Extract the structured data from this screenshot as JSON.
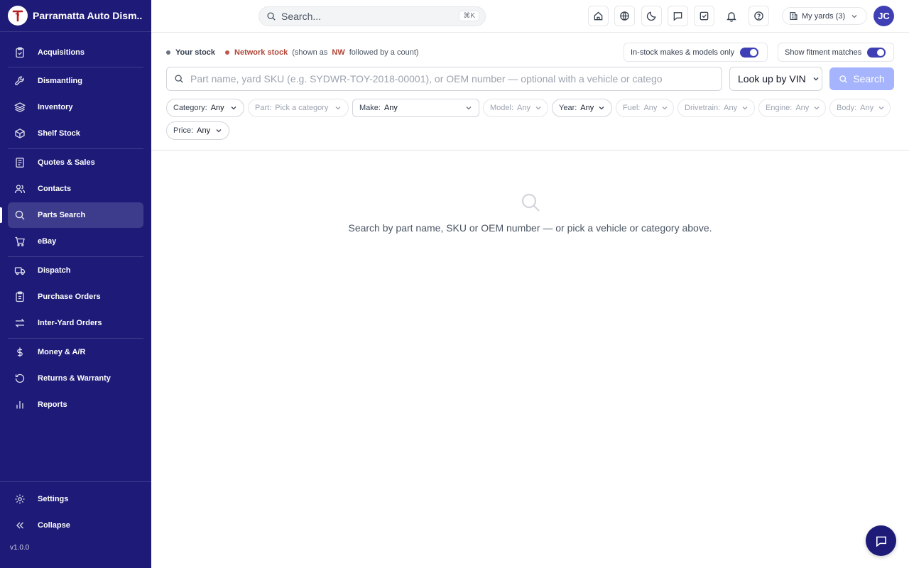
{
  "app": {
    "name": "Parramatta Auto Dism...",
    "version": "v1.0.0",
    "accent": "#1e1b78",
    "brand_color": "#3f3fb5"
  },
  "sidebar": {
    "items": [
      {
        "label": "Acquisitions",
        "icon": "clipboard-icon"
      },
      {
        "label": "Dismantling",
        "icon": "wrench-icon"
      },
      {
        "label": "Inventory",
        "icon": "layers-icon"
      },
      {
        "label": "Shelf Stock",
        "icon": "box-icon"
      },
      {
        "label": "Quotes & Sales",
        "icon": "receipt-icon"
      },
      {
        "label": "Contacts",
        "icon": "users-icon"
      },
      {
        "label": "Parts Search",
        "icon": "search-icon",
        "active": true
      },
      {
        "label": "eBay",
        "icon": "cart-icon"
      },
      {
        "label": "Dispatch",
        "icon": "truck-icon"
      },
      {
        "label": "Purchase Orders",
        "icon": "clipboard-list-icon"
      },
      {
        "label": "Inter-Yard Orders",
        "icon": "swap-icon"
      },
      {
        "label": "Money & A/R",
        "icon": "dollar-icon"
      },
      {
        "label": "Returns & Warranty",
        "icon": "rotate-icon"
      },
      {
        "label": "Reports",
        "icon": "bar-chart-icon"
      }
    ],
    "settings_label": "Settings",
    "collapse_label": "Collapse"
  },
  "topbar": {
    "search_placeholder": "Search...",
    "search_shortcut": "⌘K",
    "icons": [
      "home-icon",
      "globe-icon",
      "moon-icon",
      "message-icon",
      "check-square-icon",
      "bell-icon",
      "help-icon"
    ],
    "yards_label": "My yards (3)",
    "avatar_initials": "JC"
  },
  "stock": {
    "your_stock": "Your stock",
    "your_stock_color": "#6b7280",
    "network_stock": "Network stock",
    "network_stock_color": "#c0564b",
    "shown_as_prefix": "(shown as",
    "nw_tag": "NW",
    "shown_as_suffix": "followed by a count)",
    "toggle_instock_label": "In-stock makes & models only",
    "toggle_instock_on": true,
    "toggle_fitment_label": "Show fitment matches",
    "toggle_fitment_on": true
  },
  "search": {
    "placeholder": "Part name, yard SKU (e.g. SYDWR-TOY-2018-00001), or OEM number — optional with a vehicle or catego",
    "vin_label": "Look up by VIN",
    "search_button": "Search"
  },
  "filters": [
    {
      "key": "Category:",
      "value": "Any",
      "enabled": true
    },
    {
      "key": "Part:",
      "value": "Pick a category",
      "enabled": false
    },
    {
      "key": "Make:",
      "value": "Any",
      "enabled": true
    },
    {
      "key": "Model:",
      "value": "Any",
      "enabled": false
    },
    {
      "key": "Year:",
      "value": "Any",
      "enabled": true
    },
    {
      "key": "Fuel:",
      "value": "Any",
      "enabled": false
    },
    {
      "key": "Drivetrain:",
      "value": "Any",
      "enabled": false
    },
    {
      "key": "Engine:",
      "value": "Any",
      "enabled": false
    },
    {
      "key": "Body:",
      "value": "Any",
      "enabled": false
    },
    {
      "key": "Price:",
      "value": "Any",
      "enabled": true
    }
  ],
  "empty_state": {
    "message": "Search by part name, SKU or OEM number — or pick a vehicle or category above."
  }
}
